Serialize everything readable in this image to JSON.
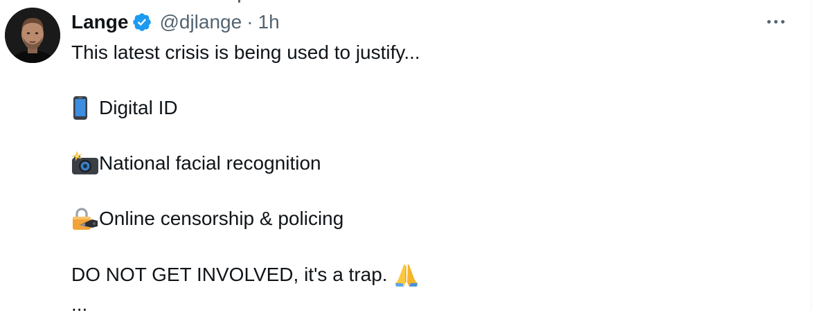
{
  "tweet": {
    "display_name": "Lange",
    "handle": "@djlange",
    "separator": "·",
    "time": "1h",
    "lines": [
      "This latest crisis is being used to justify...",
      "Digital ID",
      "National facial recognition",
      "Online censorship & policing",
      "DO NOT GET INVOLVED, it's a trap.",
      "..."
    ]
  },
  "icons": {
    "verified": "verified-badge-icon",
    "more": "more-options-icon",
    "line1": "mobile-phone-icon",
    "line2": "camera-with-flash-icon",
    "line3": "locked-with-pen-icon",
    "line4": "folded-hands-icon"
  },
  "colors": {
    "verified_blue": "#1d9bf0",
    "text": "#0f1419",
    "secondary": "#536471"
  }
}
